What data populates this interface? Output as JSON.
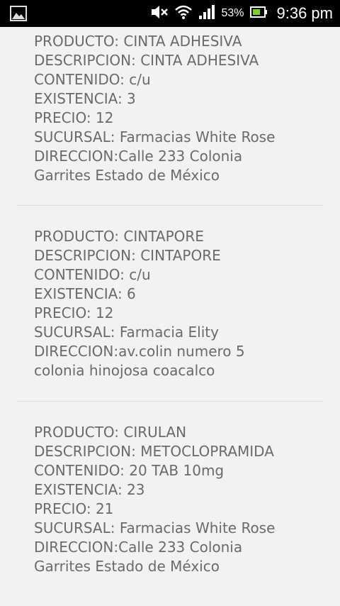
{
  "status_bar": {
    "battery_percent": "53%",
    "time": "9:36 pm"
  },
  "products": [
    {
      "producto_line": "PRODUCTO: CINTA ADHESIVA",
      "descripcion_line": "DESCRIPCION: CINTA ADHESIVA",
      "contenido_line": "CONTENIDO: c/u",
      "existencia_line": "EXISTENCIA: 3",
      "precio_line": "PRECIO: 12",
      "sucursal_line": "SUCURSAL: Farmacias White Rose",
      "direccion_line": "DIRECCION:Calle 233 Colonia Garrites Estado de México"
    },
    {
      "producto_line": "PRODUCTO: CINTAPORE",
      "descripcion_line": "DESCRIPCION: CINTAPORE",
      "contenido_line": "CONTENIDO: c/u",
      "existencia_line": "EXISTENCIA: 6",
      "precio_line": "PRECIO: 12",
      "sucursal_line": "SUCURSAL: Farmacia Elity",
      "direccion_line": "DIRECCION:av.colin numero 5 colonia hinojosa coacalco"
    },
    {
      "producto_line": "PRODUCTO: CIRULAN",
      "descripcion_line": "DESCRIPCION: METOCLOPRAMIDA",
      "contenido_line": "CONTENIDO: 20 TAB 10mg",
      "existencia_line": "EXISTENCIA: 23",
      "precio_line": "PRECIO: 21",
      "sucursal_line": "SUCURSAL: Farmacias White Rose",
      "direccion_line": "DIRECCION:Calle 233 Colonia Garrites Estado de México"
    }
  ]
}
